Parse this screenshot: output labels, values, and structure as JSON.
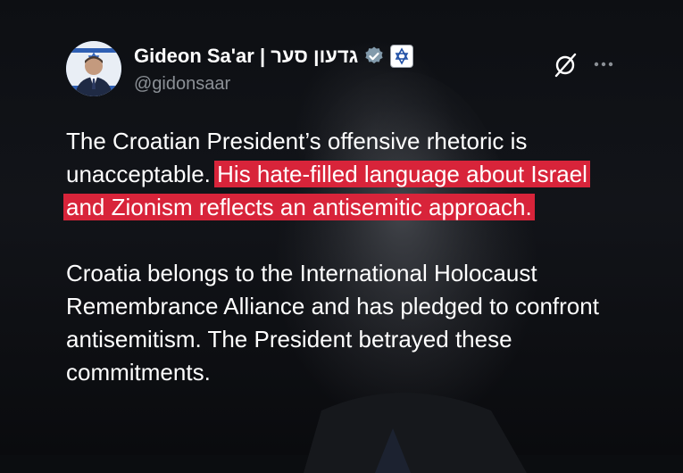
{
  "author": {
    "name": "Gideon Sa'ar | גדעון סער",
    "handle": "@gidonsaar"
  },
  "icons": {
    "verified": "verified-badge-icon",
    "affiliation": "israel-government-affiliation-icon",
    "grok": "grok-icon",
    "more": "more-options-icon"
  },
  "tweet": {
    "p1_plain": "The Croatian President’s offensive rhetoric is unacceptable. ",
    "p1_highlight": "His hate-filled language about Israel and Zionism reflects an antisemitic approach.",
    "p2": "Croatia belongs to the International Holocaust Remembrance Alliance and has pledged to confront antisemitism. The President betrayed these commitments."
  },
  "colors": {
    "highlight": "#d8243a",
    "background": "#0b0d10",
    "text": "#ffffff",
    "handle": "#8b9096",
    "verified": "#829aab"
  }
}
